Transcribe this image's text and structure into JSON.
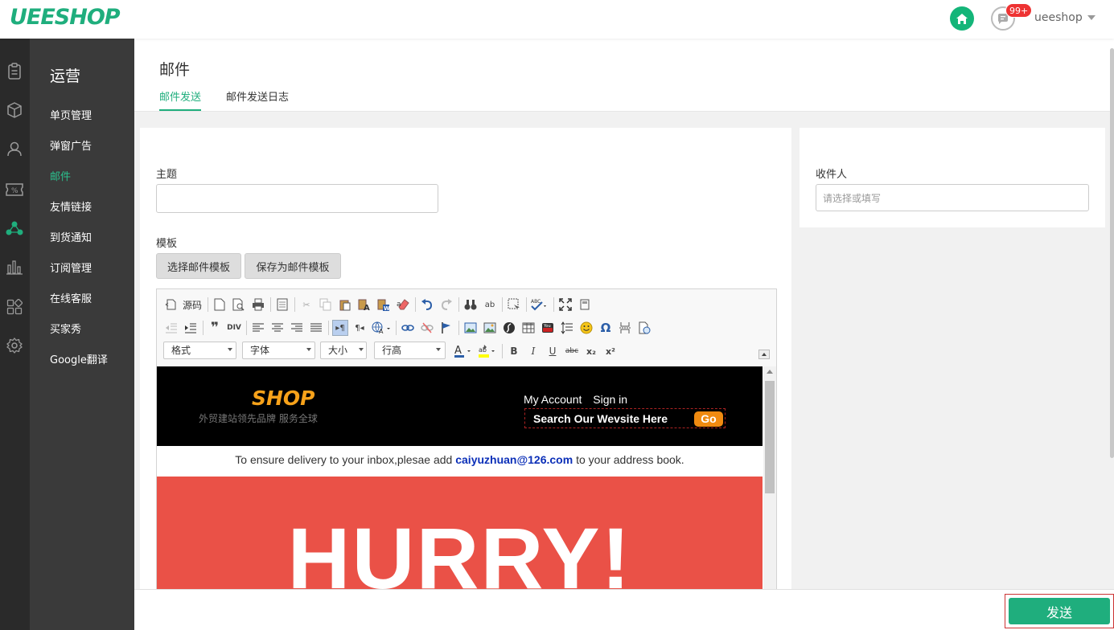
{
  "brand": {
    "logo": "UEESHOP",
    "accent": "#1fae7d"
  },
  "topbar": {
    "notif_count": "99+",
    "username": "ueeshop"
  },
  "sidebar": {
    "title": "运营",
    "items": [
      {
        "label": "单页管理"
      },
      {
        "label": "弹窗广告"
      },
      {
        "label": "邮件",
        "active": true
      },
      {
        "label": "友情链接"
      },
      {
        "label": "到货通知"
      },
      {
        "label": "订阅管理"
      },
      {
        "label": "在线客服"
      },
      {
        "label": "买家秀"
      },
      {
        "label": "Google翻译"
      }
    ],
    "icons": [
      "clipboard-icon",
      "box-icon",
      "user-icon",
      "coupon-icon",
      "share-icon",
      "chart-icon",
      "apps-icon",
      "gear-icon"
    ]
  },
  "page": {
    "title": "邮件",
    "tabs": [
      {
        "label": "邮件发送",
        "active": true
      },
      {
        "label": "邮件发送日志"
      }
    ]
  },
  "form": {
    "subject_label": "主题",
    "subject_value": "",
    "template_label": "模板",
    "choose_template": "选择邮件模板",
    "save_template": "保存为邮件模板",
    "recipient_label": "收件人",
    "recipient_placeholder": "请选择或填写"
  },
  "editor": {
    "source_label": "源码",
    "combos": {
      "format": "格式",
      "font": "字体",
      "size": "大小",
      "line_height": "行高"
    },
    "bold": "B",
    "italic": "I",
    "underline": "U",
    "strike": "abc",
    "sub": "x₂",
    "sup": "x²"
  },
  "email": {
    "shop_logo": "SHOP",
    "shop_tagline": "外贸建站领先品牌 服务全球",
    "my_account": "My Account",
    "sign_in": "Sign in",
    "search_placeholder": "Search Our Wevsite Here",
    "go": "Go",
    "notice_before": "To ensure delivery to your inbox,plesae add",
    "notice_email": "caiyuzhuan@126.com",
    "notice_after": "to your address book.",
    "hero_text": "HURRY!",
    "hero_color": "#ea5147"
  },
  "footer": {
    "send": "发送"
  }
}
